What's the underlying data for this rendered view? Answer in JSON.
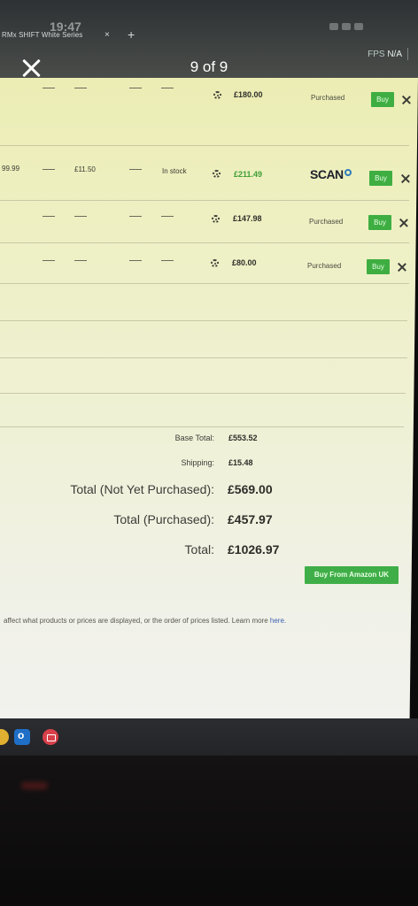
{
  "status_bar": {
    "time": "19:47"
  },
  "browser": {
    "tab_title": "RMx SHIFT White Series",
    "tab_close": "×",
    "new_tab": "+"
  },
  "overlay": {
    "fps_label": "FPS",
    "fps_value": "N/A",
    "counter": "9 of 9"
  },
  "rows": [
    {
      "base": "",
      "shipping": "",
      "availability": "",
      "total": "£180.00",
      "total_highlight": false,
      "store": "Purchased",
      "buy_label": "Buy"
    },
    {
      "base": "99.99",
      "shipping": "£11.50",
      "availability": "In stock",
      "total": "£211.49",
      "total_highlight": true,
      "store": "SCAN",
      "buy_label": "Buy"
    },
    {
      "base": "",
      "shipping": "",
      "availability": "",
      "total": "£147.98",
      "total_highlight": false,
      "store": "Purchased",
      "buy_label": "Buy"
    },
    {
      "base": "",
      "shipping": "",
      "availability": "",
      "total": "£80.00",
      "total_highlight": false,
      "store": "Purchased",
      "buy_label": "Buy"
    }
  ],
  "totals": {
    "base_total_label": "Base Total:",
    "base_total_value": "£553.52",
    "shipping_label": "Shipping:",
    "shipping_value": "£15.48",
    "not_purchased_label": "Total (Not Yet Purchased):",
    "not_purchased_value": "£569.00",
    "purchased_label": "Total (Purchased):",
    "purchased_value": "£457.97",
    "total_label": "Total:",
    "total_value": "£1026.97"
  },
  "amazon_button": "Buy From Amazon UK",
  "disclaimer": {
    "text": "affect what products or prices are displayed, or the order of prices listed. Learn more",
    "link": "here."
  },
  "colors": {
    "buy_green": "#3fae42",
    "price_green": "#3f9f36",
    "screen_bg": "#eef0c4",
    "taskbar": "#2b2d31"
  }
}
